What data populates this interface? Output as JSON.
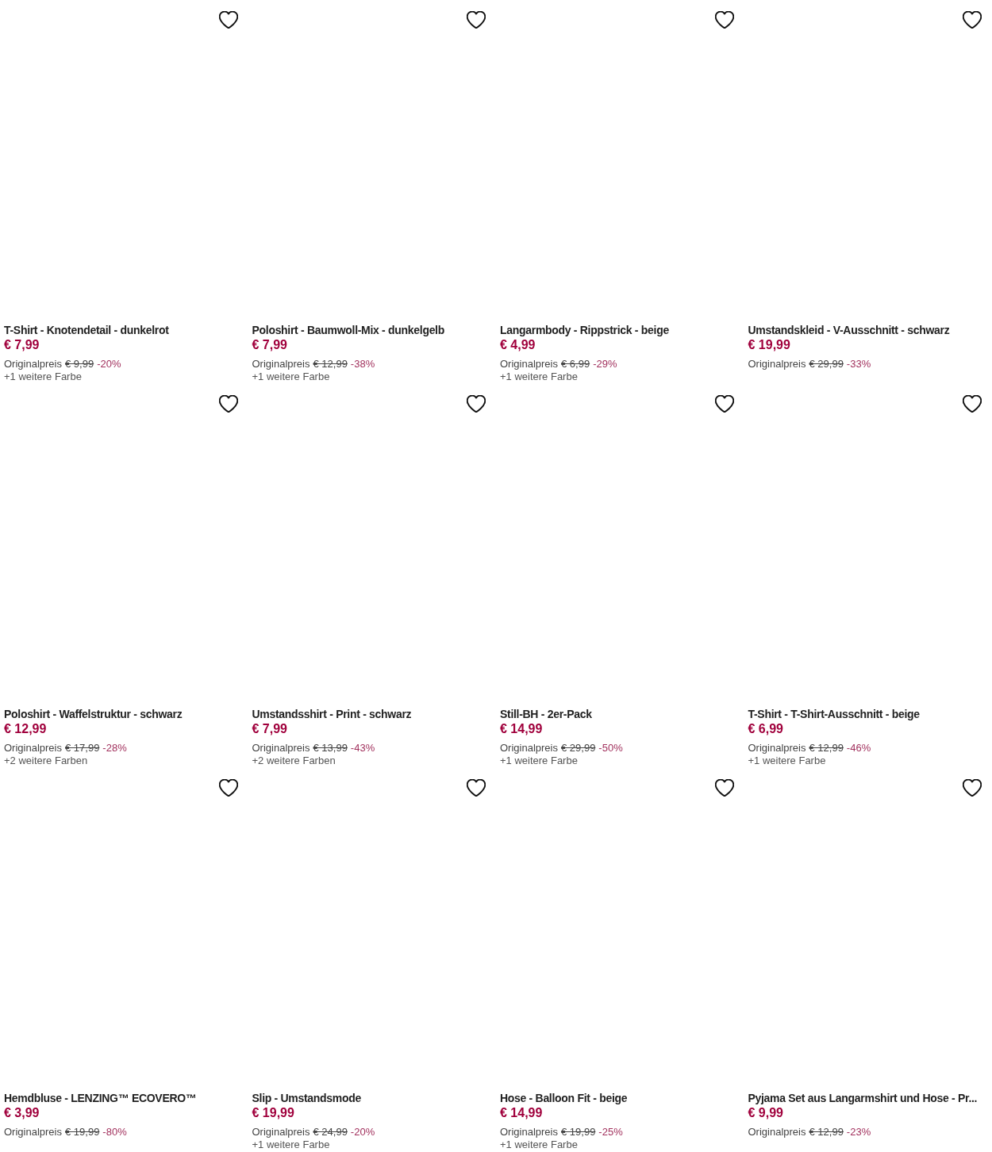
{
  "products": [
    {
      "title": "T-Shirt - Knotendetail - dunkelrot",
      "price": "€ 7,99",
      "original_label": "Originalpreis",
      "original_price": "€ 9,99",
      "discount": "-20%",
      "more_colors": "+1 weitere Farbe",
      "favorite": false
    },
    {
      "title": "Poloshirt - Baumwoll-Mix - dunkelgelb",
      "price": "€ 7,99",
      "original_label": "Originalpreis",
      "original_price": "€ 12,99",
      "discount": "-38%",
      "more_colors": "+1 weitere Farbe",
      "favorite": false
    },
    {
      "title": "Langarmbody - Rippstrick - beige",
      "price": "€ 4,99",
      "original_label": "Originalpreis",
      "original_price": "€ 6,99",
      "discount": "-29%",
      "more_colors": "+1 weitere Farbe",
      "favorite": false
    },
    {
      "title": "Umstandskleid - V-Ausschnitt - schwarz",
      "price": "€ 19,99",
      "original_label": "Originalpreis",
      "original_price": "€ 29,99",
      "discount": "-33%",
      "favorite": false
    },
    {
      "title": "Poloshirt - Waffelstruktur - schwarz",
      "price": "€ 12,99",
      "original_label": "Originalpreis",
      "original_price": "€ 17,99",
      "discount": "-28%",
      "more_colors": "+2 weitere Farben",
      "favorite": false
    },
    {
      "title": "Umstandsshirt - Print - schwarz",
      "price": "€ 7,99",
      "original_label": "Originalpreis",
      "original_price": "€ 13,99",
      "discount": "-43%",
      "more_colors": "+2 weitere Farben",
      "favorite": false
    },
    {
      "title": "Still-BH - 2er-Pack",
      "price": "€ 14,99",
      "original_label": "Originalpreis",
      "original_price": "€ 29,99",
      "discount": "-50%",
      "more_colors": "+1 weitere Farbe",
      "favorite": false
    },
    {
      "title": "T-Shirt - T-Shirt-Ausschnitt - beige",
      "price": "€ 6,99",
      "original_label": "Originalpreis",
      "original_price": "€ 12,99",
      "discount": "-46%",
      "more_colors": "+1 weitere Farbe",
      "favorite": false
    },
    {
      "title": "Hemdbluse - LENZING™ ECOVERO™",
      "price": "€ 3,99",
      "original_label": "Originalpreis",
      "original_price": "€ 19,99",
      "discount": "-80%",
      "favorite": false
    },
    {
      "title": "Slip - Umstandsmode",
      "price": "€ 19,99",
      "original_label": "Originalpreis",
      "original_price": "€ 24,99",
      "discount": "-20%",
      "more_colors": "+1 weitere Farbe",
      "favorite": false
    },
    {
      "title": "Hose - Balloon Fit - beige",
      "price": "€ 14,99",
      "original_label": "Originalpreis",
      "original_price": "€ 19,99",
      "discount": "-25%",
      "more_colors": "+1 weitere Farbe",
      "favorite": false
    },
    {
      "title": "Pyjama Set aus Langarmshirt und Hose - Pr...",
      "price": "€ 9,99",
      "original_label": "Originalpreis",
      "original_price": "€ 12,99",
      "discount": "-23%",
      "favorite": false
    }
  ]
}
